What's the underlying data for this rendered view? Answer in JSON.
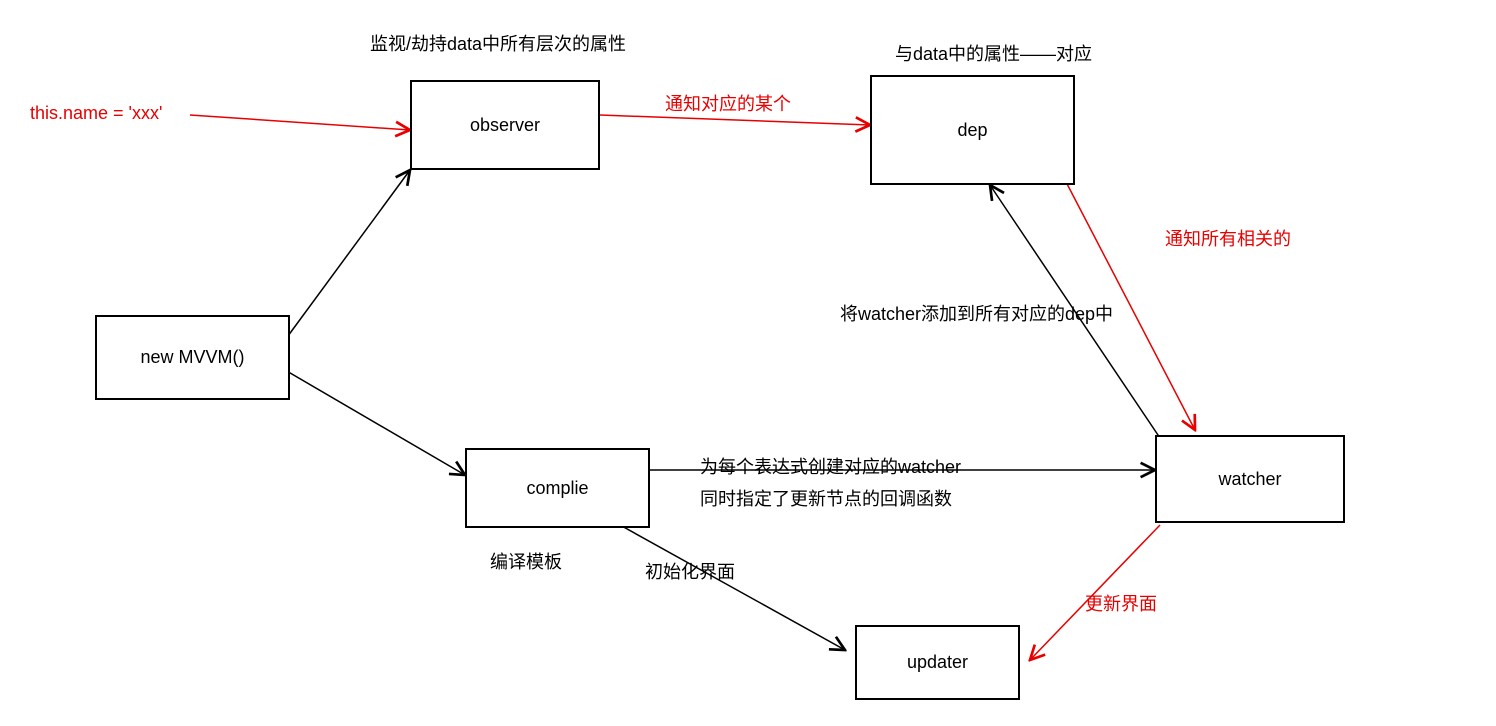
{
  "nodes": {
    "mvvm": "new MVVM()",
    "observer": "observer",
    "dep": "dep",
    "compile": "complie",
    "watcher": "watcher",
    "updater": "updater"
  },
  "labels": {
    "observer_top": "监视/劫持data中所有层次的属性",
    "dep_top": "与data中的属性——对应",
    "thisname": "this.name = 'xxx'",
    "notify_some": "通知对应的某个",
    "notify_related": "通知所有相关的",
    "watcher_add": "将watcher添加到所有对应的dep中",
    "compile_watcher_l1": "为每个表达式创建对应的watcher",
    "compile_watcher_l2": "同时指定了更新节点的回调函数",
    "compile_sub": "编译模板",
    "init_ui": "初始化界面",
    "update_ui": "更新界面"
  }
}
